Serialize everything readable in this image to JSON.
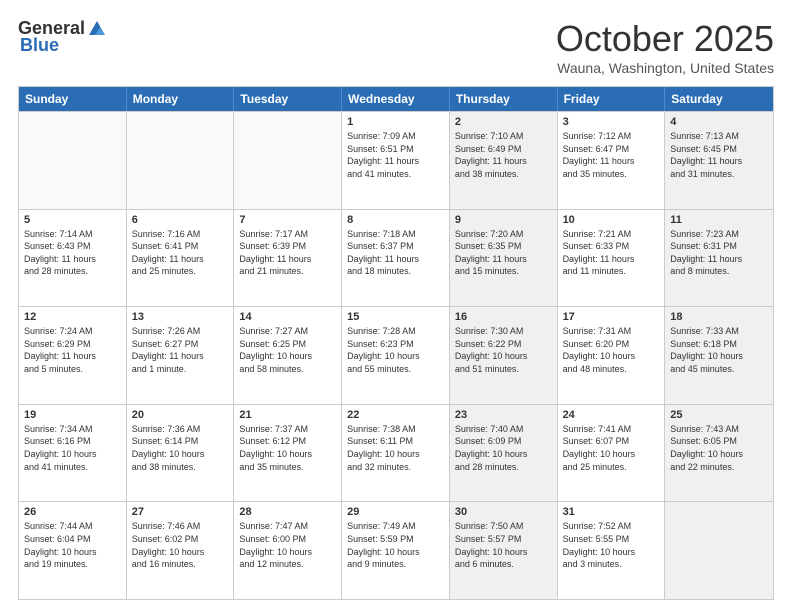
{
  "header": {
    "logo_general": "General",
    "logo_blue": "Blue",
    "month_title": "October 2025",
    "location": "Wauna, Washington, United States"
  },
  "days_of_week": [
    "Sunday",
    "Monday",
    "Tuesday",
    "Wednesday",
    "Thursday",
    "Friday",
    "Saturday"
  ],
  "rows": [
    [
      {
        "day": "",
        "empty": true,
        "shaded": false,
        "lines": []
      },
      {
        "day": "",
        "empty": true,
        "shaded": false,
        "lines": []
      },
      {
        "day": "",
        "empty": true,
        "shaded": false,
        "lines": []
      },
      {
        "day": "1",
        "empty": false,
        "shaded": false,
        "lines": [
          "Sunrise: 7:09 AM",
          "Sunset: 6:51 PM",
          "Daylight: 11 hours",
          "and 41 minutes."
        ]
      },
      {
        "day": "2",
        "empty": false,
        "shaded": true,
        "lines": [
          "Sunrise: 7:10 AM",
          "Sunset: 6:49 PM",
          "Daylight: 11 hours",
          "and 38 minutes."
        ]
      },
      {
        "day": "3",
        "empty": false,
        "shaded": false,
        "lines": [
          "Sunrise: 7:12 AM",
          "Sunset: 6:47 PM",
          "Daylight: 11 hours",
          "and 35 minutes."
        ]
      },
      {
        "day": "4",
        "empty": false,
        "shaded": true,
        "lines": [
          "Sunrise: 7:13 AM",
          "Sunset: 6:45 PM",
          "Daylight: 11 hours",
          "and 31 minutes."
        ]
      }
    ],
    [
      {
        "day": "5",
        "empty": false,
        "shaded": false,
        "lines": [
          "Sunrise: 7:14 AM",
          "Sunset: 6:43 PM",
          "Daylight: 11 hours",
          "and 28 minutes."
        ]
      },
      {
        "day": "6",
        "empty": false,
        "shaded": false,
        "lines": [
          "Sunrise: 7:16 AM",
          "Sunset: 6:41 PM",
          "Daylight: 11 hours",
          "and 25 minutes."
        ]
      },
      {
        "day": "7",
        "empty": false,
        "shaded": false,
        "lines": [
          "Sunrise: 7:17 AM",
          "Sunset: 6:39 PM",
          "Daylight: 11 hours",
          "and 21 minutes."
        ]
      },
      {
        "day": "8",
        "empty": false,
        "shaded": false,
        "lines": [
          "Sunrise: 7:18 AM",
          "Sunset: 6:37 PM",
          "Daylight: 11 hours",
          "and 18 minutes."
        ]
      },
      {
        "day": "9",
        "empty": false,
        "shaded": true,
        "lines": [
          "Sunrise: 7:20 AM",
          "Sunset: 6:35 PM",
          "Daylight: 11 hours",
          "and 15 minutes."
        ]
      },
      {
        "day": "10",
        "empty": false,
        "shaded": false,
        "lines": [
          "Sunrise: 7:21 AM",
          "Sunset: 6:33 PM",
          "Daylight: 11 hours",
          "and 11 minutes."
        ]
      },
      {
        "day": "11",
        "empty": false,
        "shaded": true,
        "lines": [
          "Sunrise: 7:23 AM",
          "Sunset: 6:31 PM",
          "Daylight: 11 hours",
          "and 8 minutes."
        ]
      }
    ],
    [
      {
        "day": "12",
        "empty": false,
        "shaded": false,
        "lines": [
          "Sunrise: 7:24 AM",
          "Sunset: 6:29 PM",
          "Daylight: 11 hours",
          "and 5 minutes."
        ]
      },
      {
        "day": "13",
        "empty": false,
        "shaded": false,
        "lines": [
          "Sunrise: 7:26 AM",
          "Sunset: 6:27 PM",
          "Daylight: 11 hours",
          "and 1 minute."
        ]
      },
      {
        "day": "14",
        "empty": false,
        "shaded": false,
        "lines": [
          "Sunrise: 7:27 AM",
          "Sunset: 6:25 PM",
          "Daylight: 10 hours",
          "and 58 minutes."
        ]
      },
      {
        "day": "15",
        "empty": false,
        "shaded": false,
        "lines": [
          "Sunrise: 7:28 AM",
          "Sunset: 6:23 PM",
          "Daylight: 10 hours",
          "and 55 minutes."
        ]
      },
      {
        "day": "16",
        "empty": false,
        "shaded": true,
        "lines": [
          "Sunrise: 7:30 AM",
          "Sunset: 6:22 PM",
          "Daylight: 10 hours",
          "and 51 minutes."
        ]
      },
      {
        "day": "17",
        "empty": false,
        "shaded": false,
        "lines": [
          "Sunrise: 7:31 AM",
          "Sunset: 6:20 PM",
          "Daylight: 10 hours",
          "and 48 minutes."
        ]
      },
      {
        "day": "18",
        "empty": false,
        "shaded": true,
        "lines": [
          "Sunrise: 7:33 AM",
          "Sunset: 6:18 PM",
          "Daylight: 10 hours",
          "and 45 minutes."
        ]
      }
    ],
    [
      {
        "day": "19",
        "empty": false,
        "shaded": false,
        "lines": [
          "Sunrise: 7:34 AM",
          "Sunset: 6:16 PM",
          "Daylight: 10 hours",
          "and 41 minutes."
        ]
      },
      {
        "day": "20",
        "empty": false,
        "shaded": false,
        "lines": [
          "Sunrise: 7:36 AM",
          "Sunset: 6:14 PM",
          "Daylight: 10 hours",
          "and 38 minutes."
        ]
      },
      {
        "day": "21",
        "empty": false,
        "shaded": false,
        "lines": [
          "Sunrise: 7:37 AM",
          "Sunset: 6:12 PM",
          "Daylight: 10 hours",
          "and 35 minutes."
        ]
      },
      {
        "day": "22",
        "empty": false,
        "shaded": false,
        "lines": [
          "Sunrise: 7:38 AM",
          "Sunset: 6:11 PM",
          "Daylight: 10 hours",
          "and 32 minutes."
        ]
      },
      {
        "day": "23",
        "empty": false,
        "shaded": true,
        "lines": [
          "Sunrise: 7:40 AM",
          "Sunset: 6:09 PM",
          "Daylight: 10 hours",
          "and 28 minutes."
        ]
      },
      {
        "day": "24",
        "empty": false,
        "shaded": false,
        "lines": [
          "Sunrise: 7:41 AM",
          "Sunset: 6:07 PM",
          "Daylight: 10 hours",
          "and 25 minutes."
        ]
      },
      {
        "day": "25",
        "empty": false,
        "shaded": true,
        "lines": [
          "Sunrise: 7:43 AM",
          "Sunset: 6:05 PM",
          "Daylight: 10 hours",
          "and 22 minutes."
        ]
      }
    ],
    [
      {
        "day": "26",
        "empty": false,
        "shaded": false,
        "lines": [
          "Sunrise: 7:44 AM",
          "Sunset: 6:04 PM",
          "Daylight: 10 hours",
          "and 19 minutes."
        ]
      },
      {
        "day": "27",
        "empty": false,
        "shaded": false,
        "lines": [
          "Sunrise: 7:46 AM",
          "Sunset: 6:02 PM",
          "Daylight: 10 hours",
          "and 16 minutes."
        ]
      },
      {
        "day": "28",
        "empty": false,
        "shaded": false,
        "lines": [
          "Sunrise: 7:47 AM",
          "Sunset: 6:00 PM",
          "Daylight: 10 hours",
          "and 12 minutes."
        ]
      },
      {
        "day": "29",
        "empty": false,
        "shaded": false,
        "lines": [
          "Sunrise: 7:49 AM",
          "Sunset: 5:59 PM",
          "Daylight: 10 hours",
          "and 9 minutes."
        ]
      },
      {
        "day": "30",
        "empty": false,
        "shaded": true,
        "lines": [
          "Sunrise: 7:50 AM",
          "Sunset: 5:57 PM",
          "Daylight: 10 hours",
          "and 6 minutes."
        ]
      },
      {
        "day": "31",
        "empty": false,
        "shaded": false,
        "lines": [
          "Sunrise: 7:52 AM",
          "Sunset: 5:55 PM",
          "Daylight: 10 hours",
          "and 3 minutes."
        ]
      },
      {
        "day": "",
        "empty": true,
        "shaded": true,
        "lines": []
      }
    ]
  ]
}
